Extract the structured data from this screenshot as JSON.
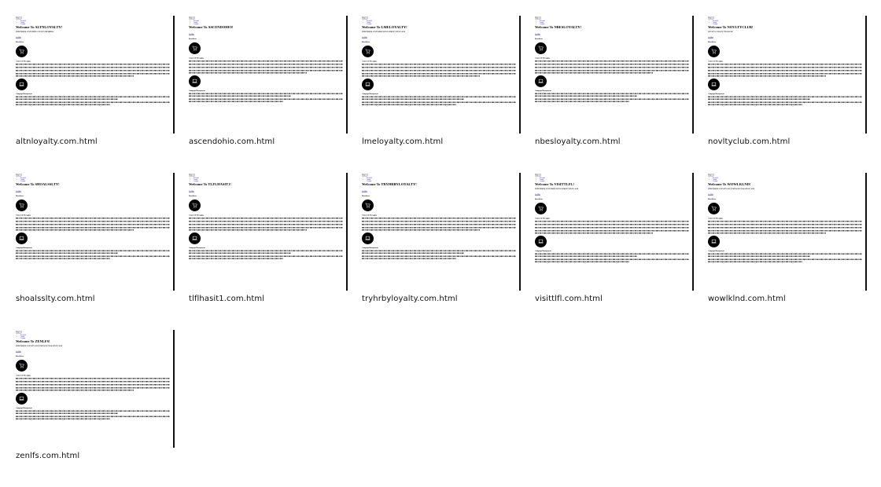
{
  "thumbnail_common": {
    "skip_link": "Skip to",
    "nav_items": [
      "Rewards",
      "About",
      "Contact"
    ],
    "feature_heading": "Beneficios",
    "section_1": "Connected Messaging",
    "section_2": "Campaign Management",
    "cta_link": "Ver Más"
  },
  "tiles": [
    {
      "filename": "altnloyalty.com.html",
      "welcome": "Welcome To ALTNLOYALTY!",
      "subtitle": "PREFERRED CUSTOMER LOYALTY MEMBERS",
      "has_subtitle": true
    },
    {
      "filename": "ascendohio.com.html",
      "welcome": "Welcome To ASCENDOHIO!",
      "subtitle": "",
      "has_subtitle": false
    },
    {
      "filename": "lmeloyalty.com.html",
      "welcome": "Welcome To LMELOYALTY!",
      "subtitle": "PREFERRED CUSTOMER MANAGEMENT SINCE 2010",
      "has_subtitle": true
    },
    {
      "filename": "nbesloyalty.com.html",
      "welcome": "Welcome To NBESLOYALTY!",
      "subtitle": "",
      "has_subtitle": false
    },
    {
      "filename": "novltyclub.com.html",
      "welcome": "Welcome To NOVLTYCLUB!",
      "subtitle": "NOVLTY LOYALTY PROGRAM",
      "has_subtitle": true
    },
    {
      "filename": "shoalsslty.com.html",
      "welcome": "Welcome To SHOALSSLTY!",
      "subtitle": "",
      "has_subtitle": false
    },
    {
      "filename": "tlflhasit1.com.html",
      "welcome": "Welcome To TLFLHASIT1!",
      "subtitle": "",
      "has_subtitle": false
    },
    {
      "filename": "tryhrbyloyalty.com.html",
      "welcome": "Welcome To TRYHRBYLOYALTY!",
      "subtitle": "",
      "has_subtitle": false
    },
    {
      "filename": "visittlfl.com.html",
      "welcome": "Welcome To VISITTLFL!",
      "subtitle": "PREFERRED CUSTOMER MANAGEMENT SINCE 2010",
      "has_subtitle": true
    },
    {
      "filename": "wowlklnd.com.html",
      "welcome": "Welcome To WOWLKLND!",
      "subtitle": "PREFERRED LOYALTY SOLUTIONS IN POLK SINCE 2018",
      "has_subtitle": true
    },
    {
      "filename": "zenlfs.com.html",
      "welcome": "Welcome To ZENLFS!",
      "subtitle": "PREFERRED LOYALTY SOLUTIONS IN POLK SINCE 2018",
      "has_subtitle": true
    }
  ]
}
